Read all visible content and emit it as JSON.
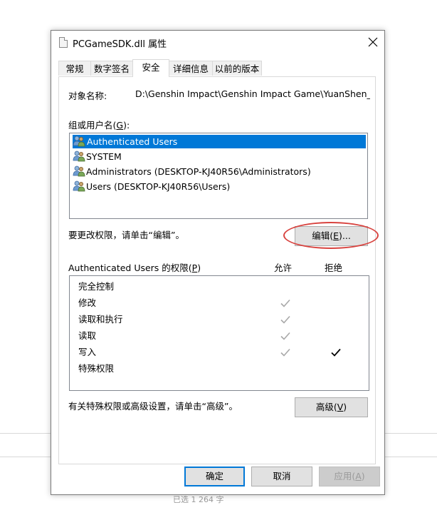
{
  "window": {
    "title": "PCGameSDK.dll 属性",
    "close_label": "✕"
  },
  "tabs": [
    {
      "label": "常规",
      "active": false
    },
    {
      "label": "数字签名",
      "active": false
    },
    {
      "label": "安全",
      "active": true
    },
    {
      "label": "详细信息",
      "active": false
    },
    {
      "label": "以前的版本",
      "active": false
    }
  ],
  "security": {
    "object_name_label": "对象名称:",
    "object_name_value": "D:\\Genshin Impact\\Genshin Impact Game\\YuanShen_Dat",
    "groups_label": "组或用户名(",
    "groups_accel": "G",
    "groups_label_end": "):",
    "users": [
      {
        "name": "Authenticated Users",
        "selected": true
      },
      {
        "name": "SYSTEM",
        "selected": false
      },
      {
        "name": "Administrators (DESKTOP-KJ40R56\\Administrators)",
        "selected": false
      },
      {
        "name": "Users (DESKTOP-KJ40R56\\Users)",
        "selected": false
      }
    ],
    "change_hint": "要更改权限，请单击“编辑”。",
    "edit_button": "编辑(",
    "edit_accel": "E",
    "edit_button_end": ")...",
    "perm_label": "Authenticated Users 的权限(",
    "perm_accel": "P",
    "perm_label_end": ")",
    "allow_header": "允许",
    "deny_header": "拒绝",
    "permissions": [
      {
        "name": "完全控制",
        "allow": false,
        "deny": false
      },
      {
        "name": "修改",
        "allow": true,
        "deny": false
      },
      {
        "name": "读取和执行",
        "allow": true,
        "deny": false
      },
      {
        "name": "读取",
        "allow": true,
        "deny": false
      },
      {
        "name": "写入",
        "allow": true,
        "deny": true
      },
      {
        "name": "特殊权限",
        "allow": false,
        "deny": false
      }
    ],
    "advanced_hint": "有关特殊权限或高级设置，请单击“高级”。",
    "advanced_button": "高级(",
    "advanced_accel": "V",
    "advanced_button_end": ")"
  },
  "footer": {
    "ok": "确定",
    "cancel": "取消",
    "apply": "应用(",
    "apply_accel": "A",
    "apply_end": ")"
  },
  "background": {
    "partial_text": "已选 1 264 字"
  },
  "colors": {
    "selection": "#0078d7",
    "annotation": "#d8433f"
  }
}
